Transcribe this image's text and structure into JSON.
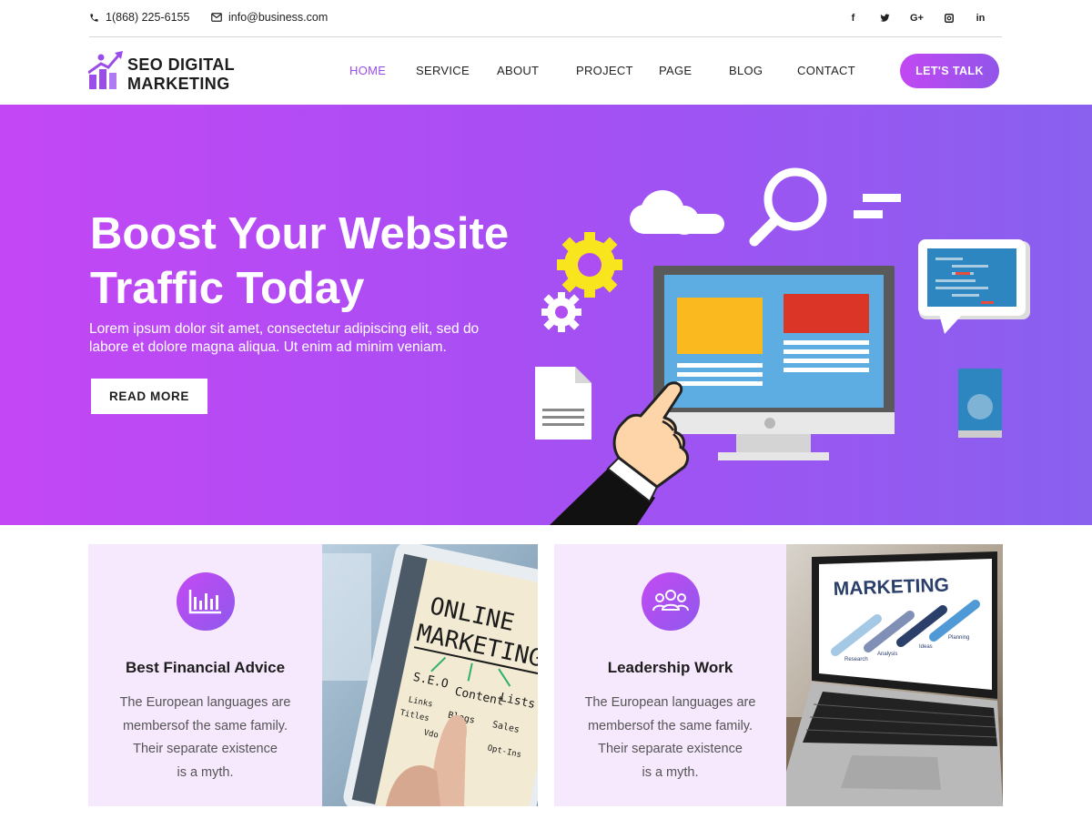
{
  "topbar": {
    "phone": "1(868) 225-6155",
    "email": "info@business.com",
    "social": [
      {
        "icon": "facebook-icon",
        "glyph": "f"
      },
      {
        "icon": "twitter-icon",
        "glyph": "t"
      },
      {
        "icon": "google-plus-icon",
        "glyph": "G+"
      },
      {
        "icon": "instagram-icon",
        "glyph": "◙"
      },
      {
        "icon": "linkedin-icon",
        "glyph": "in"
      }
    ]
  },
  "logo": {
    "line1": "SEO DIGITAL",
    "line2": "MARKETING"
  },
  "nav": {
    "items": [
      "HOME",
      "SERVICE",
      "ABOUT",
      "PROJECT",
      "PAGE",
      "BLOG",
      "CONTACT"
    ],
    "active": "HOME",
    "cta": "LET'S TALK"
  },
  "hero": {
    "title_line1": "Boost Your Website",
    "title_line2": "Traffic Today",
    "subtitle_line1": "Lorem ipsum dolor sit amet, consectetur adipiscing elit, sed do",
    "subtitle_line2": "labore et dolore magna aliqua. Ut enim ad minim veniam.",
    "button": "READ MORE"
  },
  "features": [
    {
      "icon": "bar-chart-icon",
      "title": "Best Financial Advice",
      "lines": [
        "The European languages are",
        "membersof the same family.",
        "Their separate existence",
        "is a myth."
      ]
    },
    {
      "icon": "team-icon",
      "title": "Leadership Work",
      "lines": [
        "The European languages are",
        "membersof the same family.",
        "Their separate existence",
        "is a myth."
      ]
    }
  ],
  "photos": {
    "tablet": {
      "line1": "ONLINE",
      "line2": "MARKETING",
      "notes": [
        "S.E.O",
        "Content",
        "Lists",
        "Links",
        "Titles",
        "Blogs",
        "Sales",
        "Vdo",
        "Opt-Ins"
      ]
    },
    "laptop": {
      "title": "MARKETING",
      "labels": [
        "Research",
        "Analysis",
        "Ideas",
        "Planning"
      ]
    }
  },
  "colors": {
    "accent": "#9b4dea",
    "gradient_start": "#c447f5",
    "gradient_end": "#8960ef",
    "card_bg": "#f6e8fd"
  }
}
